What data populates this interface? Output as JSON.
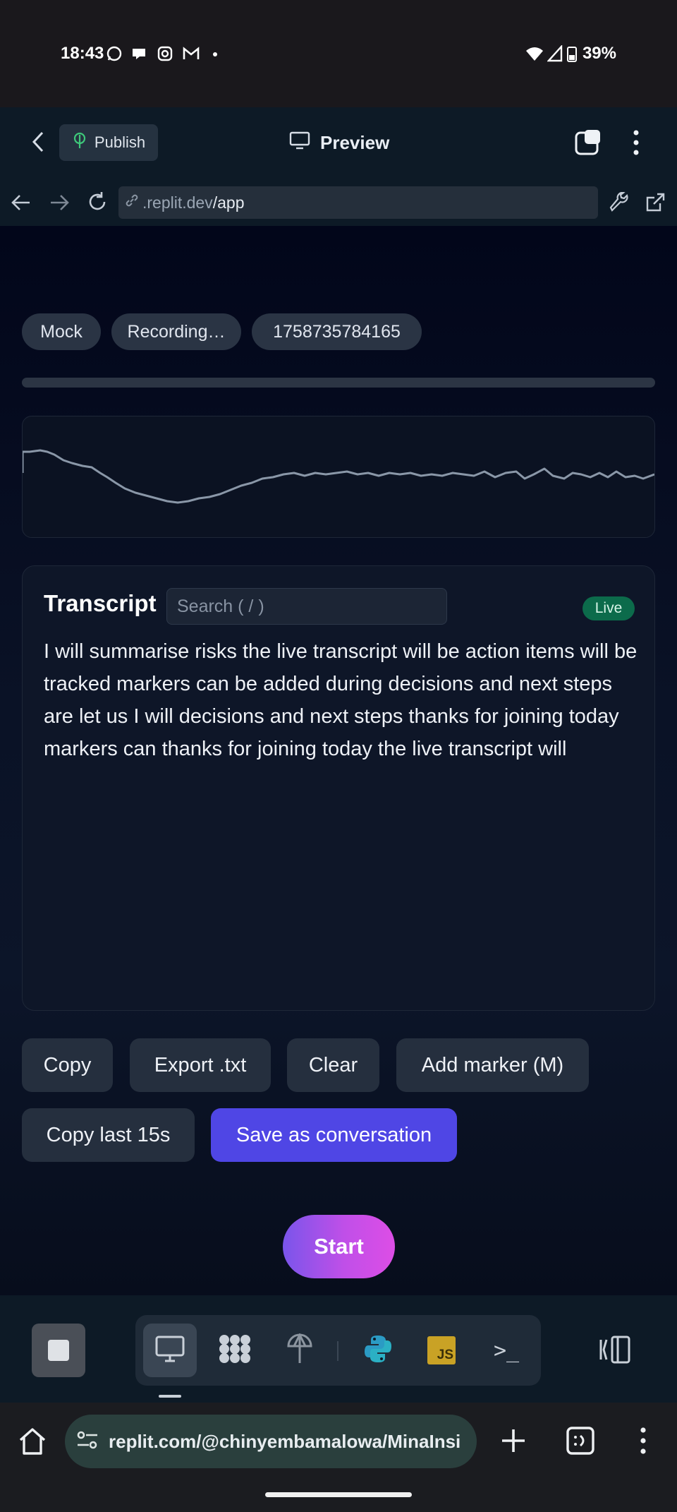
{
  "status_bar": {
    "time": "18:43",
    "battery": "39%"
  },
  "header": {
    "publish_label": "Publish",
    "preview_label": "Preview"
  },
  "url_bar": {
    "domain": ".replit.dev",
    "path": "/app"
  },
  "chips": [
    "Mock",
    "Recording…",
    "1758735784165"
  ],
  "transcript": {
    "title": "Transcript",
    "search_placeholder": "Search ( / )",
    "live_badge": "Live",
    "text": "I will summarise risks the live transcript will be action items will be tracked markers can be added during decisions and next steps are let us I will decisions and next steps thanks for joining today markers can thanks for joining today the live transcript will"
  },
  "actions": {
    "copy": "Copy",
    "export": "Export .txt",
    "clear": "Clear",
    "add_marker": "Add marker (M)",
    "copy_last": "Copy last 15s",
    "save": "Save as conversation"
  },
  "start_label": "Start",
  "dock": {
    "tools": [
      "desktop-icon",
      "apps-icon",
      "publish-icon",
      "python-icon",
      "js-icon",
      "terminal-icon"
    ],
    "js_label": "JS",
    "terminal_label": ">_"
  },
  "browser": {
    "url": "replit.com/@chinyembamalowa/MinaInsi"
  },
  "colors": {
    "accent": "#4f46e5",
    "live": "#0c6b4b",
    "start_from": "#7a55ea",
    "start_to": "#dd4ee6"
  }
}
